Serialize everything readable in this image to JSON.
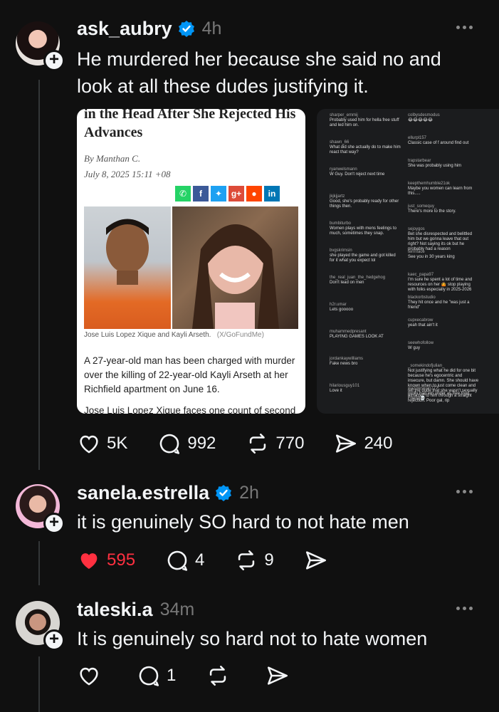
{
  "posts": [
    {
      "username": "ask_aubry",
      "verified": true,
      "time": "4h",
      "text": "He murdered her because she said no and look at all these dudes justifying it.",
      "likes": "5K",
      "comments": "992",
      "reposts": "770",
      "shares": "240",
      "liked": false
    },
    {
      "username": "sanela.estrella",
      "verified": true,
      "time": "2h",
      "text": "it is genuinely SO hard to not hate men",
      "likes": "595",
      "comments": "4",
      "reposts": "9",
      "shares": "",
      "liked": true
    },
    {
      "username": "taleski.a",
      "verified": false,
      "time": "34m",
      "text": "It is genuinely so hard not to hate women",
      "likes": "",
      "comments": "1",
      "reposts": "",
      "shares": "",
      "liked": false
    }
  ],
  "article": {
    "headline_line1": "in the Head After She Rejected His",
    "headline_line2": "Advances",
    "author": "By Manthan C.",
    "date": "July 8, 2025 15:11 +08",
    "caption": "Jose Luis Lopez Xique and Kayli Arseth.",
    "caption_credit": "(X/GoFundMe)",
    "body": "A 27-year-old man has been charged with murder over the killing of 22-year-old Kayli Arseth at her Richfield apartment on June 16.",
    "body_cut": "Jose Luis Lopez Xique faces one count of second"
  },
  "comments_shot": [
    {
      "user": "sharper_emmij",
      "text": "Probably used him for hella free stuff and led him on."
    },
    {
      "user": "shawn_66",
      "text": "What did she actually do to make him react that way?"
    },
    {
      "user": "ryanwelsmann",
      "text": "W Guy. Don't reject next time"
    },
    {
      "user": "jkjkjjartz",
      "text": "Good, she's probably ready for other things then."
    },
    {
      "user": "bumbiturbo",
      "text": "Women plays with mens feelings to much, sometimes they snap."
    },
    {
      "user": "bvgskrimsin",
      "text": "she played the game and got killed for it what you expect lol"
    },
    {
      "user": "the_real_juan_the_hedgehog",
      "text": "Don't lead on men"
    },
    {
      "user": "h2r.umar",
      "text": "Lets gooooo"
    },
    {
      "user": "muhammedpresant",
      "text": "PLAYING GAMES LOOK AT"
    },
    {
      "user": "jordankaywilliams",
      "text": "Fake news bro"
    },
    {
      "user": "hilariousguy101",
      "text": "Love it"
    },
    {
      "user": "colbysdesmodus",
      "text": "😂😂😂😂😂"
    },
    {
      "user": "ellurpl157",
      "text": "Classic case of f around find out"
    },
    {
      "user": "trapstarbear",
      "text": "She was probably using him"
    },
    {
      "user": "keepthemhumble21ok",
      "text": "Maybe you women can learn from this....."
    },
    {
      "user": "just_somequy_",
      "text": "There's more to the story."
    },
    {
      "user": "sejoygos",
      "text": "Bet she disrespected and belittled him but we gonna leave that out right? Not saying its ok but he probably had a reason"
    },
    {
      "user": "terrnface",
      "text": "See you in 30 years king"
    },
    {
      "user": "kaec_papa97",
      "text": "I'm sure he spent a lot of time and resources on her 🤷 stop playing with folks especially in 2025-2026"
    },
    {
      "user": "blackorbstudio",
      "text": "They hit once and he \"was just a friend\""
    },
    {
      "user": "cupxecabrow",
      "text": "yeah that ain't it"
    },
    {
      "user": "seewhofollow",
      "text": "W guy"
    },
    {
      "user": "_somekindofjulian_",
      "text": "Not justifying what he did for one bit because he's egocentric and insecure, but damn. She should have known when to just come clean and tell the dude that she wasn't sexually attracted to him through a straight rejection. Poor gal, rip"
    },
    {
      "user": "wazowskian777",
      "text": "prolly had em under as free food Friend💀"
    }
  ]
}
